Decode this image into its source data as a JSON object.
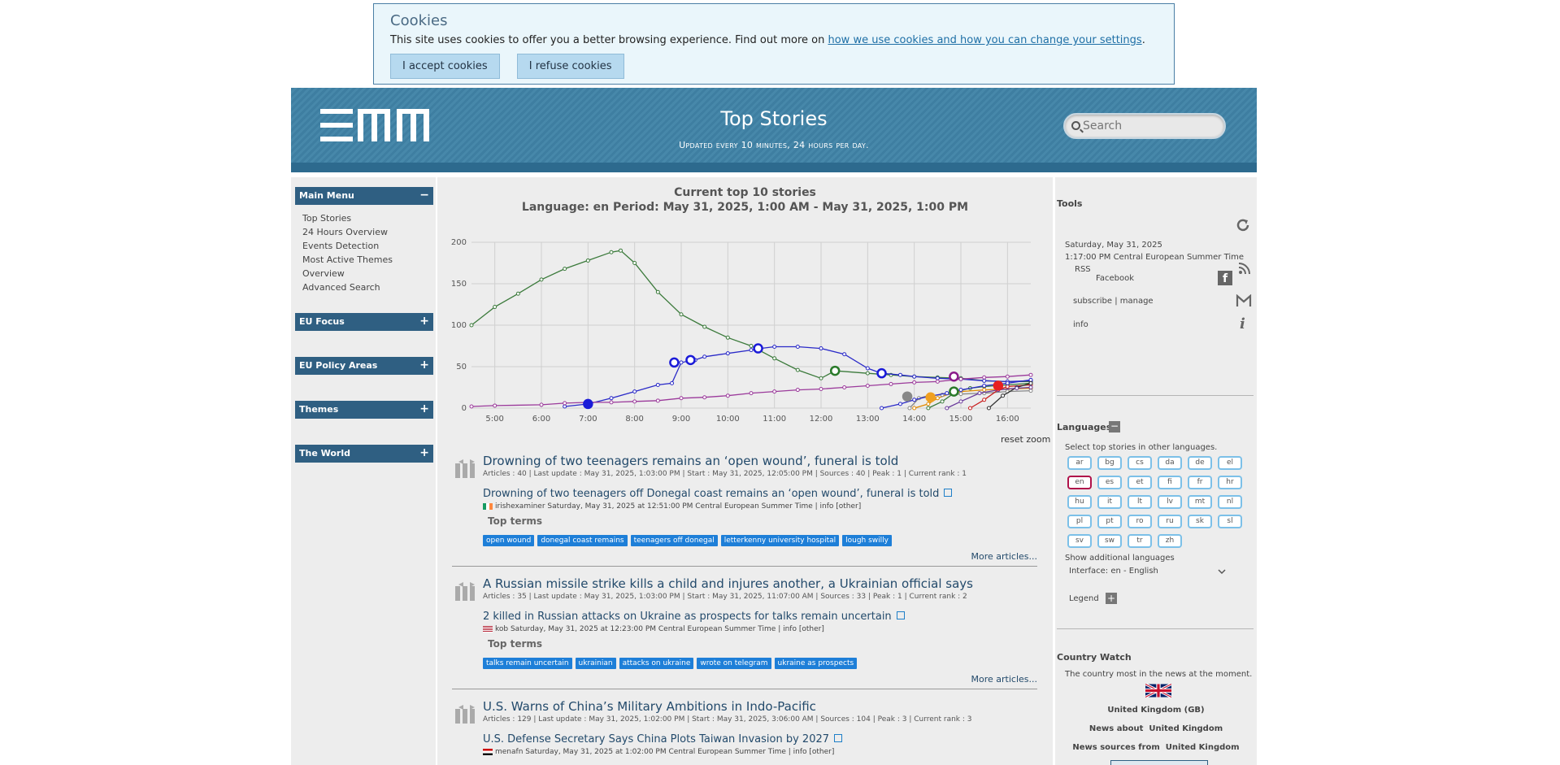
{
  "cookie": {
    "title": "Cookies",
    "text": "This site uses cookies to offer you a better browsing experience. Find out more on ",
    "link": "how we use cookies and how you can change your settings",
    "text_end": ".",
    "accept": "I accept cookies",
    "refuse": "I refuse cookies"
  },
  "header": {
    "title": "Top Stories",
    "subtitle": "Updated every 10 minutes, 24 hours per day.",
    "search_placeholder": "Search"
  },
  "leftbar": {
    "main_menu": "Main Menu",
    "main_menu_toggle": "−",
    "links": [
      "Top Stories",
      "24 Hours Overview",
      "Events Detection",
      "Most Active Themes",
      "Overview",
      "Advanced Search"
    ],
    "sections": [
      "EU Focus",
      "EU Policy Areas",
      "Themes",
      "The World"
    ],
    "expand": "+"
  },
  "chart_title_1": "Current top 10 stories",
  "chart_title_2": "Language: en Period: May 31, 2025, 1:00 AM - May 31, 2025, 1:00 PM",
  "reset_zoom": "reset zoom",
  "chart_data": {
    "type": "line",
    "title": "Current top 10 stories",
    "subtitle": "Language: en Period: May 31, 2025, 1:00 AM - May 31, 2025, 1:00 PM",
    "x_ticks": [
      "5:00",
      "6:00",
      "7:00",
      "8:00",
      "9:00",
      "10:00",
      "11:00",
      "12:00",
      "13:00",
      "14:00",
      "15:00",
      "16:00"
    ],
    "y_ticks": [
      0,
      50,
      100,
      150,
      200
    ],
    "ylim": [
      0,
      200
    ],
    "xlim": [
      4.5,
      16.5
    ],
    "grid": true,
    "series": [
      {
        "color": "#3b7a3b",
        "points": [
          [
            4.5,
            100
          ],
          [
            5,
            122
          ],
          [
            5.5,
            138
          ],
          [
            6,
            155
          ],
          [
            6.5,
            168
          ],
          [
            7,
            178
          ],
          [
            7.5,
            188
          ],
          [
            7.7,
            190
          ],
          [
            8,
            175
          ],
          [
            8.5,
            140
          ],
          [
            9,
            113
          ],
          [
            9.5,
            98
          ],
          [
            10,
            85
          ],
          [
            10.5,
            75
          ],
          [
            11,
            60
          ],
          [
            11.5,
            46
          ],
          [
            12,
            36
          ],
          [
            12.3,
            45
          ],
          [
            13,
            42
          ],
          [
            13.5,
            40
          ],
          [
            14,
            38
          ],
          [
            14.5,
            37
          ],
          [
            15,
            36
          ],
          [
            15.5,
            33
          ],
          [
            16,
            32
          ],
          [
            16.5,
            32
          ]
        ]
      },
      {
        "color": "#2a2ac8",
        "points": [
          [
            6.5,
            2
          ],
          [
            7,
            5
          ],
          [
            7.5,
            12
          ],
          [
            8,
            20
          ],
          [
            8.5,
            28
          ],
          [
            8.8,
            30
          ],
          [
            9,
            55
          ],
          [
            9.3,
            58
          ],
          [
            9.5,
            62
          ],
          [
            10,
            66
          ],
          [
            10.5,
            70
          ],
          [
            10.7,
            72
          ],
          [
            11,
            74
          ],
          [
            11.5,
            74
          ],
          [
            12,
            72
          ],
          [
            12.5,
            65
          ],
          [
            13,
            48
          ],
          [
            13.3,
            42
          ],
          [
            13.7,
            40
          ],
          [
            14,
            38
          ],
          [
            14.5,
            36
          ],
          [
            15,
            35
          ],
          [
            15.5,
            33
          ],
          [
            16,
            32
          ],
          [
            16.5,
            33
          ]
        ]
      },
      {
        "color": "#9b3a9b",
        "points": [
          [
            4.5,
            2
          ],
          [
            5,
            3
          ],
          [
            6,
            4
          ],
          [
            6.5,
            6
          ],
          [
            7,
            7
          ],
          [
            7.5,
            7
          ],
          [
            8,
            8
          ],
          [
            8.5,
            9
          ],
          [
            9,
            12
          ],
          [
            9.5,
            13
          ],
          [
            10,
            15
          ],
          [
            10.5,
            18
          ],
          [
            11,
            20
          ],
          [
            11.5,
            22
          ],
          [
            12,
            23
          ],
          [
            12.5,
            25
          ],
          [
            13,
            27
          ],
          [
            13.5,
            29
          ],
          [
            14,
            31
          ],
          [
            14.5,
            32
          ],
          [
            15,
            35
          ],
          [
            15.5,
            37
          ],
          [
            16,
            38
          ],
          [
            16.5,
            40
          ]
        ]
      },
      {
        "color": "#3b7a3b",
        "points": [
          [
            14.3,
            0
          ],
          [
            14.6,
            8
          ],
          [
            14.9,
            20
          ],
          [
            15.2,
            24
          ],
          [
            15.5,
            26
          ],
          [
            16,
            28
          ],
          [
            16.5,
            30
          ]
        ]
      },
      {
        "color": "#e08a00",
        "points": [
          [
            14,
            0
          ],
          [
            14.3,
            5
          ],
          [
            14.5,
            12
          ],
          [
            14.8,
            18
          ],
          [
            15,
            20
          ],
          [
            15.5,
            22
          ],
          [
            16,
            23
          ],
          [
            16.5,
            24
          ]
        ]
      },
      {
        "color": "#888888",
        "points": [
          [
            13.9,
            0
          ],
          [
            14.1,
            12
          ],
          [
            14.3,
            15
          ],
          [
            14.6,
            16
          ],
          [
            15,
            17
          ],
          [
            15.5,
            18
          ],
          [
            16,
            20
          ],
          [
            16.5,
            21
          ]
        ]
      },
      {
        "color": "#c82020",
        "points": [
          [
            15.2,
            0
          ],
          [
            15.5,
            10
          ],
          [
            15.8,
            22
          ],
          [
            16,
            26
          ],
          [
            16.5,
            28
          ]
        ]
      },
      {
        "color": "#2a2ac8",
        "points": [
          [
            13.3,
            0
          ],
          [
            13.7,
            5
          ],
          [
            14,
            10
          ],
          [
            14.3,
            14
          ],
          [
            14.7,
            18
          ],
          [
            15,
            22
          ],
          [
            15.5,
            27
          ],
          [
            16,
            30
          ],
          [
            16.5,
            34
          ]
        ]
      },
      {
        "color": "#333333",
        "points": [
          [
            15.6,
            0
          ],
          [
            15.9,
            15
          ],
          [
            16.2,
            25
          ],
          [
            16.5,
            30
          ]
        ]
      },
      {
        "color": "#6a3a9b",
        "points": [
          [
            14.7,
            0
          ],
          [
            15,
            8
          ],
          [
            15.4,
            18
          ],
          [
            15.8,
            22
          ],
          [
            16.2,
            24
          ],
          [
            16.5,
            25
          ]
        ]
      }
    ],
    "markers": [
      {
        "x": 7.0,
        "y": 5,
        "color": "#1a1ad8",
        "filled": true
      },
      {
        "x": 8.85,
        "y": 55,
        "color": "#1a1ad8",
        "filled": false
      },
      {
        "x": 9.2,
        "y": 58,
        "color": "#1a1ad8",
        "filled": false
      },
      {
        "x": 10.65,
        "y": 72,
        "color": "#1a1ad8",
        "filled": false
      },
      {
        "x": 12.3,
        "y": 45,
        "color": "#2a7a2a",
        "filled": false
      },
      {
        "x": 13.3,
        "y": 42,
        "color": "#1a1ad8",
        "filled": false
      },
      {
        "x": 13.85,
        "y": 14,
        "color": "#888888",
        "filled": true
      },
      {
        "x": 14.35,
        "y": 13,
        "color": "#f0a020",
        "filled": true
      },
      {
        "x": 14.85,
        "y": 20,
        "color": "#2a7a2a",
        "filled": false
      },
      {
        "x": 14.85,
        "y": 38,
        "color": "#8a1a8a",
        "filled": false
      },
      {
        "x": 15.8,
        "y": 27,
        "color": "#e82020",
        "filled": true
      }
    ]
  },
  "stories": [
    {
      "title": "Drowning of two teenagers remains an ‘open wound’, funeral is told",
      "meta": "Articles : 40 | Last update : May 31, 2025, 1:03:00 PM | Start : May 31, 2025, 12:05:00 PM | Sources : 40 | Peak : 1 | Current rank : 1",
      "article": "Drowning of two teenagers off Donegal coast remains an ‘open wound’, funeral is told",
      "source": "irishexaminer Saturday, May 31, 2025 at 12:51:00 PM Central European Summer Time | info [other]",
      "top_terms": "Top terms",
      "terms": [
        "open wound",
        "donegal coast remains",
        "teenagers off donegal",
        "letterkenny university hospital",
        "lough swilly"
      ],
      "more": "More articles..."
    },
    {
      "title": "A Russian missile strike kills a child and injures another, a Ukrainian official says",
      "meta": "Articles : 35 | Last update : May 31, 2025, 1:03:00 PM | Start : May 31, 2025, 11:07:00 AM | Sources : 33 | Peak : 1 | Current rank : 2",
      "article": "2 killed in Russian attacks on Ukraine as prospects for talks remain uncertain",
      "source": "kob Saturday, May 31, 2025 at 12:23:00 PM Central European Summer Time | info [other]",
      "top_terms": "Top terms",
      "terms": [
        "talks remain uncertain",
        "ukrainian",
        "attacks on ukraine",
        "wrote on telegram",
        "ukraine as prospects"
      ],
      "more": "More articles..."
    },
    {
      "title": "U.S. Warns of China’s Military Ambitions in Indo-Pacific",
      "meta": "Articles : 129 | Last update : May 31, 2025, 1:02:00 PM | Start : May 31, 2025, 3:06:00 AM | Sources : 104 | Peak : 3 | Current rank : 3",
      "article": "U.S. Defense Secretary Says China Plots Taiwan Invasion by 2027",
      "source": "menafn Saturday, May 31, 2025 at 1:02:00 PM Central European Summer Time | info [other]"
    }
  ],
  "rightbar": {
    "tools": "Tools",
    "date": "Saturday, May 31, 2025",
    "time": "1:17:00 PM Central European Summer Time",
    "rss": "RSS",
    "facebook": "Facebook",
    "subscribe": "subscribe",
    "sep": "|",
    "manage": "manage",
    "info": "info",
    "languages": "Languages",
    "lang_hint": "Select top stories in other languages.",
    "langs": [
      "ar",
      "bg",
      "cs",
      "da",
      "de",
      "el",
      "en",
      "es",
      "et",
      "fi",
      "fr",
      "hr",
      "hu",
      "it",
      "lt",
      "lv",
      "mt",
      "nl",
      "pl",
      "pt",
      "ro",
      "ru",
      "sk",
      "sl",
      "sv",
      "sw",
      "tr",
      "zh"
    ],
    "selected_lang": "en",
    "show_additional": "Show additional languages",
    "interface": "Interface: en - English",
    "legend": "Legend",
    "country_watch": "Country Watch",
    "country_hint": "The country most in the news at the moment.",
    "country": "United Kingdom (GB)",
    "news_about": "News about",
    "news_sources_from": "News sources from",
    "country_short": "United Kingdom"
  }
}
